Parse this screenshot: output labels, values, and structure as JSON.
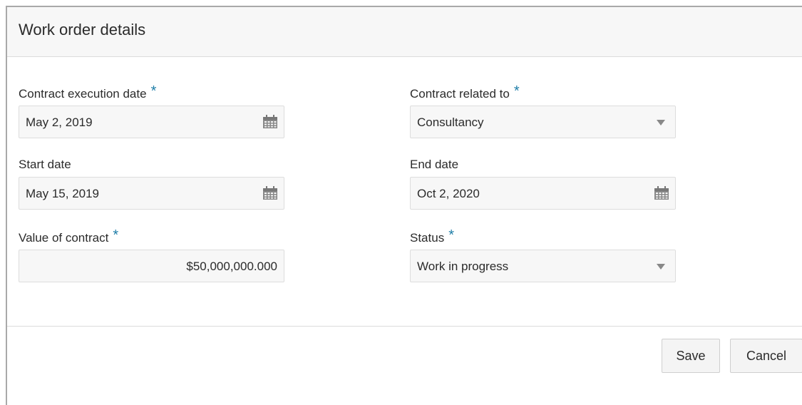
{
  "dialog": {
    "title": "Work order details"
  },
  "fields": {
    "contract_execution_date": {
      "label": "Contract execution date",
      "required_marker": "*",
      "value": "May 2, 2019",
      "icon": "calendar-icon"
    },
    "contract_related_to": {
      "label": "Contract related to",
      "required_marker": "*",
      "value": "Consultancy",
      "icon": "chevron-down-icon"
    },
    "start_date": {
      "label": "Start date",
      "value": "May 15, 2019",
      "icon": "calendar-icon"
    },
    "end_date": {
      "label": "End date",
      "value": "Oct 2, 2020",
      "icon": "calendar-icon"
    },
    "value_of_contract": {
      "label": "Value of contract",
      "required_marker": "*",
      "value": "$50,000,000.000"
    },
    "status": {
      "label": "Status",
      "required_marker": "*",
      "value": "Work in progress",
      "icon": "chevron-down-icon"
    }
  },
  "buttons": {
    "save_label": "Save",
    "cancel_label": "Cancel"
  },
  "colors": {
    "required_marker": "#1f7ea8",
    "header_background": "#f7f7f7",
    "input_background": "#f7f7f7"
  }
}
